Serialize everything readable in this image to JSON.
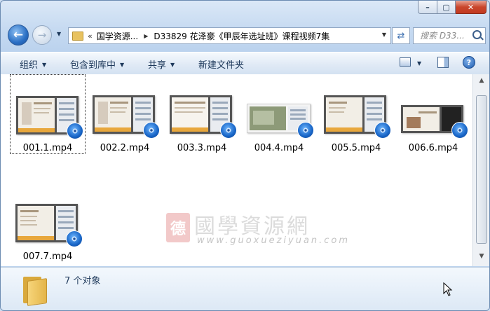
{
  "window": {
    "caption_buttons": [
      "minimize",
      "maximize",
      "close"
    ]
  },
  "nav": {
    "address_chevron": "«",
    "breadcrumb": [
      "国学资源...",
      "D33829 花泽豪《甲辰年选址班》课程视频7集"
    ],
    "search_placeholder": "搜索 D33...",
    "icons": [
      "back-arrow-icon",
      "forward-arrow-icon",
      "folder-icon",
      "refresh-icon",
      "search-icon"
    ]
  },
  "toolbar": {
    "organize": "组织",
    "include_in_library": "包含到库中",
    "share": "共享",
    "new_folder": "新建文件夹",
    "icons": [
      "view-icon",
      "preview-pane-icon",
      "help-icon"
    ]
  },
  "files": [
    {
      "name": "001.1.mp4",
      "selected": true
    },
    {
      "name": "002.2.mp4",
      "selected": false
    },
    {
      "name": "003.3.mp4",
      "selected": false
    },
    {
      "name": "004.4.mp4",
      "selected": false
    },
    {
      "name": "005.5.mp4",
      "selected": false
    },
    {
      "name": "006.6.mp4",
      "selected": false
    },
    {
      "name": "007.7.mp4",
      "selected": false
    }
  ],
  "watermark": {
    "seal": "德",
    "title": "國學資源網",
    "url": "www.guoxueziyuan.com"
  },
  "details": {
    "count_text": "7 个对象"
  },
  "colors": {
    "accent": "#1e395b",
    "selection_border": "#333333",
    "close_button": "#c9462c"
  }
}
